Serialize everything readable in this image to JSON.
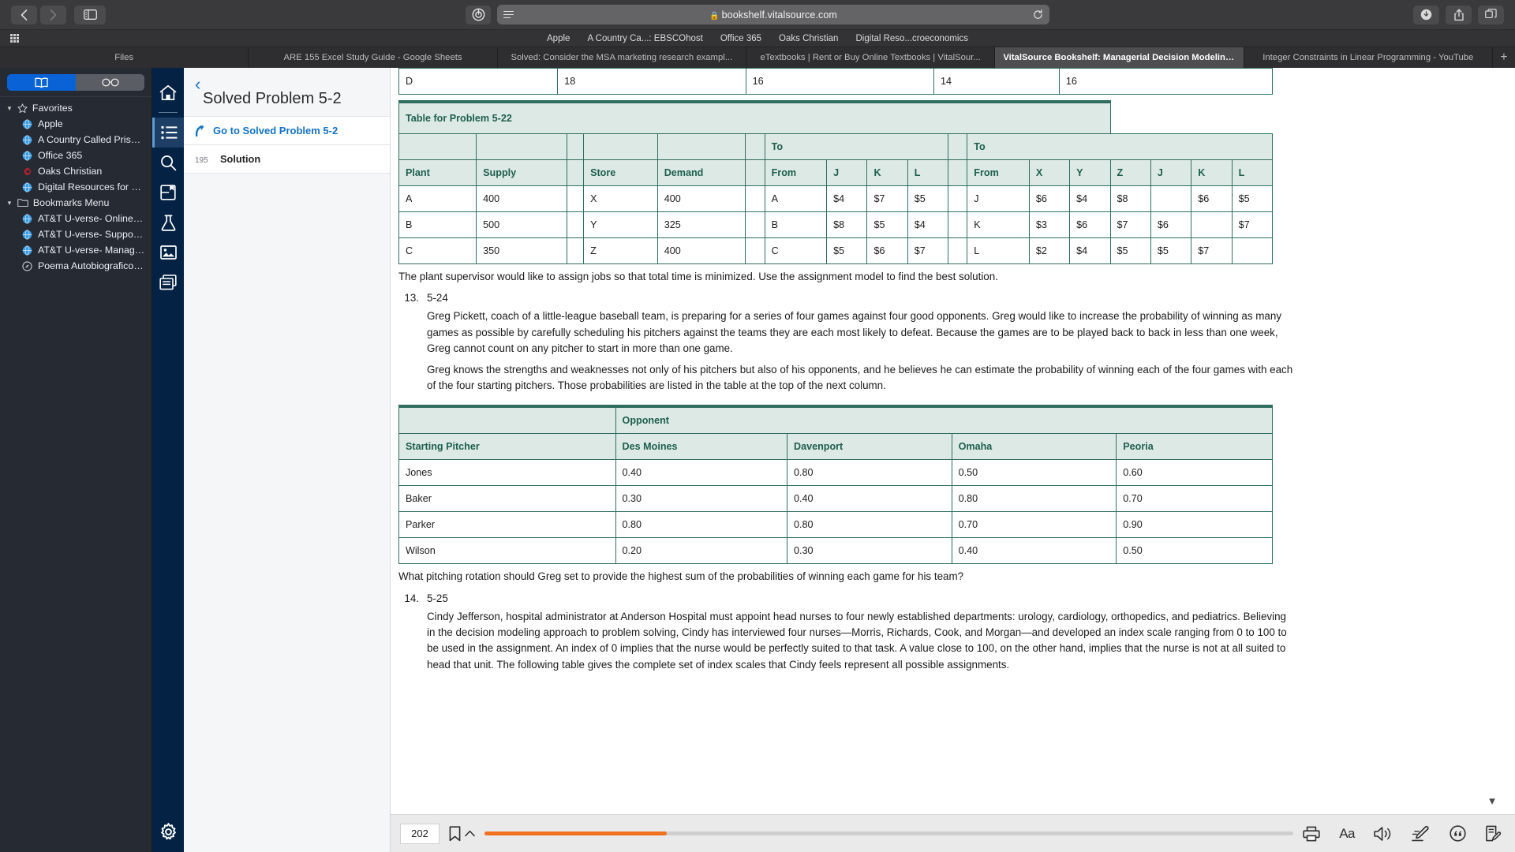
{
  "browser": {
    "url": "bookshelf.vitalsource.com",
    "lock_icon": "lock-icon",
    "back_icon": "back-arrow-icon",
    "forward_icon": "forward-arrow-icon",
    "sidebar_icon": "sidebar-toggle-icon",
    "reader_icon": "reader-mode-icon",
    "reload_icon": "reload-icon",
    "download_icon": "download-icon",
    "share_icon": "share-icon",
    "tabs_overview_icon": "tab-overview-icon",
    "apps_grid_icon": "apps-grid-icon",
    "bookmarks": [
      {
        "label": "Apple"
      },
      {
        "label": "A Country Ca...: EBSCOhost"
      },
      {
        "label": "Office 365"
      },
      {
        "label": "Oaks Christian"
      },
      {
        "label": "Digital Reso...croeconomics"
      }
    ],
    "tabs": [
      {
        "label": "Files",
        "active": false
      },
      {
        "label": "ARE 155 Excel Study Guide - Google Sheets",
        "active": false
      },
      {
        "label": "Solved: Consider the MSA marketing research exampl...",
        "active": false
      },
      {
        "label": "eTextbooks | Rent or Buy Online Textbooks | VitalSour...",
        "active": false
      },
      {
        "label": "VitalSource Bookshelf: Managerial Decision Modeling...",
        "active": true
      },
      {
        "label": "Integer Constraints in Linear Programming - YouTube",
        "active": false
      }
    ],
    "new_tab_label": "+"
  },
  "favorites_sidebar": {
    "segment": {
      "bookmarks_icon": "book-icon",
      "reading_list_icon": "glasses-icon",
      "selected": "bookmarks"
    },
    "groups": [
      {
        "title": "Favorites",
        "icon": "star-icon",
        "items": [
          {
            "label": "Apple",
            "icon": "globe-icon"
          },
          {
            "label": "A Country Called Prison :...",
            "icon": "globe-icon"
          },
          {
            "label": "Office 365",
            "icon": "globe-icon"
          },
          {
            "label": "Oaks Christian",
            "icon": "oaks-christian-icon"
          },
          {
            "label": "Digital Resources for Macr...",
            "icon": "globe-icon"
          }
        ]
      },
      {
        "title": "Bookmarks Menu",
        "icon": "folder-icon",
        "items": [
          {
            "label": "AT&T U-verse- Online Self...",
            "icon": "globe-icon"
          },
          {
            "label": "AT&T U-verse- Support Site",
            "icon": "globe-icon"
          },
          {
            "label": "AT&T U-verse- Manage Yo...",
            "icon": "globe-icon"
          },
          {
            "label": "Poema Autobiografico Fini...",
            "icon": "compass-icon"
          }
        ]
      }
    ]
  },
  "vitalsource": {
    "rail": [
      {
        "name": "home",
        "icon": "home-icon",
        "active": false
      },
      {
        "name": "contents",
        "icon": "list-icon",
        "active": true
      },
      {
        "name": "search",
        "icon": "search-icon",
        "active": false
      },
      {
        "name": "bookmarks",
        "icon": "bookmark-panel-icon",
        "active": false
      },
      {
        "name": "flashcards",
        "icon": "flask-icon",
        "active": false
      },
      {
        "name": "figures",
        "icon": "image-icon",
        "active": false
      },
      {
        "name": "notes",
        "icon": "pages-icon",
        "active": false
      }
    ],
    "settings_icon": "gear-icon",
    "toc": {
      "back_icon": "chevron-left-icon",
      "title": "Solved Problem 5-2",
      "goto_icon": "jump-arrow-icon",
      "goto_label": "Go to Solved Problem 5-2",
      "entries": [
        {
          "page": "195",
          "label": "Solution"
        }
      ]
    },
    "bottom": {
      "page_number": "202",
      "bookmark_icon": "bookmark-icon",
      "bookmark_chevron_icon": "chevron-up-icon",
      "progress_percent": 22.5,
      "progress_color": "#f07020",
      "icons": [
        {
          "name": "print-icon",
          "label": ""
        },
        {
          "name": "text-size-icon",
          "label": "Aa"
        },
        {
          "name": "read-aloud-icon",
          "label": ""
        },
        {
          "name": "highlighter-icon",
          "label": ""
        },
        {
          "name": "citation-icon",
          "label": ""
        },
        {
          "name": "notes-edit-icon",
          "label": ""
        }
      ]
    },
    "scroll_down_icon": "chevron-down-icon"
  },
  "content": {
    "top_partial_row": [
      "D",
      "18",
      "16",
      "14",
      "16"
    ],
    "table_5_22": {
      "caption": "Table for Problem 5-22",
      "group_headers": {
        "to_1": "To",
        "to_2": "To"
      },
      "headers": [
        "Plant",
        "Supply",
        "",
        "Store",
        "Demand",
        "",
        "From",
        "J",
        "K",
        "L",
        "",
        "From",
        "X",
        "Y",
        "Z",
        "J",
        "K",
        "L"
      ],
      "rows": [
        [
          "A",
          "400",
          "",
          "X",
          "400",
          "",
          "A",
          "$4",
          "$7",
          "$5",
          "",
          "J",
          "$6",
          "$4",
          "$8",
          "",
          "$6",
          "$5"
        ],
        [
          "B",
          "500",
          "",
          "Y",
          "325",
          "",
          "B",
          "$8",
          "$5",
          "$4",
          "",
          "K",
          "$3",
          "$6",
          "$7",
          "$6",
          "",
          "$7"
        ],
        [
          "C",
          "350",
          "",
          "Z",
          "400",
          "",
          "C",
          "$5",
          "$6",
          "$7",
          "",
          "L",
          "$2",
          "$4",
          "$5",
          "$5",
          "$7",
          ""
        ]
      ]
    },
    "para_supervisor": "The plant supervisor would like to assign jobs so that total time is minimized. Use the assignment model to find the best solution.",
    "item_13": {
      "number": "13.",
      "problem_id": "5-24",
      "paragraphs": [
        "Greg Pickett, coach of a little-league baseball team, is preparing for a series of four games against four good opponents. Greg would like to increase the probability of winning as many games as possible by carefully scheduling his pitchers against the teams they are each most likely to defeat. Because the games are to be played back to back in less than one week, Greg cannot count on any pitcher to start in more than one game.",
        "Greg knows the strengths and weaknesses not only of his pitchers but also of his opponents, and he believes he can estimate the probability of winning each of the four games with each of the four starting pitchers. Those probabilities are listed in the table at the top of the next column."
      ],
      "question": "What pitching rotation should Greg set to provide the highest sum of the probabilities of winning each game for his team?"
    },
    "table_pitchers": {
      "group_header": "Opponent",
      "headers": [
        "Starting Pitcher",
        "Des Moines",
        "Davenport",
        "Omaha",
        "Peoria"
      ],
      "rows": [
        [
          "Jones",
          "0.40",
          "0.80",
          "0.50",
          "0.60"
        ],
        [
          "Baker",
          "0.30",
          "0.40",
          "0.80",
          "0.70"
        ],
        [
          "Parker",
          "0.80",
          "0.80",
          "0.70",
          "0.90"
        ],
        [
          "Wilson",
          "0.20",
          "0.30",
          "0.40",
          "0.50"
        ]
      ]
    },
    "item_14": {
      "number": "14.",
      "problem_id": "5-25",
      "paragraphs": [
        "Cindy Jefferson, hospital administrator at Anderson Hospital must appoint head nurses to four newly established departments: urology, cardiology, orthopedics, and pediatrics. Believing in the decision modeling approach to problem solving, Cindy has interviewed four nurses—Morris, Richards, Cook, and Morgan—and developed an index scale ranging from 0 to 100 to be used in the assignment. An index of 0 implies that the nurse would be perfectly suited to that task. A value close to 100, on the other hand, implies that the nurse is not at all suited to head that unit. The following table gives the complete set of index scales that Cindy feels represent all possible assignments."
      ]
    }
  }
}
